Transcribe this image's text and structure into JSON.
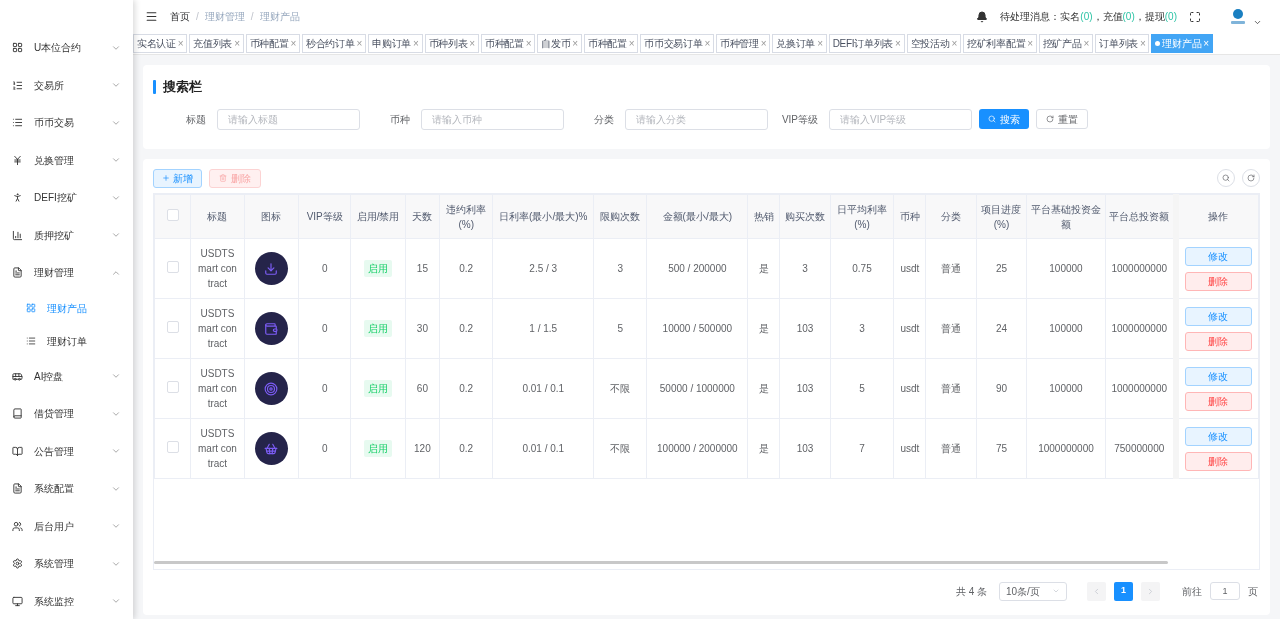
{
  "breadcrumb": {
    "items": [
      "首页",
      "理财管理",
      "理财产品"
    ],
    "separator": "/"
  },
  "notice": {
    "label": "待处理消息：",
    "items": [
      {
        "label": "实名",
        "count": "(0)"
      },
      {
        "label": "，充值",
        "count": "(0)"
      },
      {
        "label": "，提现",
        "count": "(0)"
      }
    ]
  },
  "sidebar": {
    "items": [
      {
        "label": "U本位合约",
        "expanded": false
      },
      {
        "label": "交易所",
        "expanded": false
      },
      {
        "label": "币币交易",
        "expanded": false
      },
      {
        "label": "兑换管理",
        "expanded": false
      },
      {
        "label": "DEFI挖矿",
        "expanded": false
      },
      {
        "label": "质押挖矿",
        "expanded": false
      },
      {
        "label": "理财管理",
        "expanded": true,
        "children": [
          {
            "label": "理财产品",
            "selected": true
          },
          {
            "label": "理财订单",
            "selected": false
          }
        ]
      },
      {
        "label": "AI控盘",
        "expanded": false
      },
      {
        "label": "借贷管理",
        "expanded": false
      },
      {
        "label": "公告管理",
        "expanded": false
      },
      {
        "label": "系统配置",
        "expanded": false
      },
      {
        "label": "后台用户",
        "expanded": false
      },
      {
        "label": "系统管理",
        "expanded": false
      },
      {
        "label": "系统监控",
        "expanded": false
      }
    ]
  },
  "tabs": [
    {
      "label": "实名认证",
      "close": "×",
      "selected": false
    },
    {
      "label": "充值列表",
      "close": "×",
      "selected": false
    },
    {
      "label": "币种配置",
      "close": "×",
      "selected": false
    },
    {
      "label": "秒合约订单",
      "close": "×",
      "selected": false
    },
    {
      "label": "申购订单",
      "close": "×",
      "selected": false
    },
    {
      "label": "币种列表",
      "close": "×",
      "selected": false
    },
    {
      "label": "币种配置",
      "close": "×",
      "selected": false
    },
    {
      "label": "自发币",
      "close": "×",
      "selected": false
    },
    {
      "label": "币种配置",
      "close": "×",
      "selected": false
    },
    {
      "label": "币币交易订单",
      "close": "×",
      "selected": false
    },
    {
      "label": "币种管理",
      "close": "×",
      "selected": false
    },
    {
      "label": "兑换订单",
      "close": "×",
      "selected": false
    },
    {
      "label": "DEFI订单列表",
      "close": "×",
      "selected": false
    },
    {
      "label": "空投活动",
      "close": "×",
      "selected": false
    },
    {
      "label": "挖矿利率配置",
      "close": "×",
      "selected": false
    },
    {
      "label": "挖矿产品",
      "close": "×",
      "selected": false
    },
    {
      "label": "订单列表",
      "close": "×",
      "selected": false
    },
    {
      "label": "理财产品",
      "close": "×",
      "selected": true
    }
  ],
  "search_panel": {
    "title": "搜索栏",
    "fields": [
      {
        "label": "标题",
        "placeholder": "请输入标题"
      },
      {
        "label": "币种",
        "placeholder": "请输入币种"
      },
      {
        "label": "分类",
        "placeholder": "请输入分类"
      },
      {
        "label": "VIP等级",
        "placeholder": "请输入VIP等级"
      }
    ],
    "search_button": "搜索",
    "reset_button": "重置"
  },
  "toolbar": {
    "add_button": "新增",
    "delete_button": {
      "label": "删除",
      "disabled": true
    }
  },
  "table": {
    "select_all_checked": false,
    "columns": [
      "标题",
      "图标",
      "VIP等级",
      "启用/禁用",
      "天数",
      "违约利率(%)",
      "日利率(最小/最大)%",
      "限购次数",
      "金额(最小/最大)",
      "热销",
      "购买次数",
      "日平均利率(%)",
      "币种",
      "分类",
      "项目进度(%)",
      "平台基础投资金额",
      "平台总投资额",
      "操作"
    ],
    "rows": [
      {
        "checked": false,
        "title": "USDTSmart contract",
        "vip": "0",
        "status": {
          "label": "启用",
          "on": true
        },
        "days": "15",
        "penalty": "0.2",
        "daily_rate": "2.5 / 3",
        "limit": "3",
        "amount": "500 / 200000",
        "hot": "是",
        "purchases": "3",
        "avg_rate": "0.75",
        "coin": "usdt",
        "category": "普通",
        "progress": "25",
        "base_investment": "100000",
        "total_investment": "1000000000",
        "actions": [
          "修改",
          "删除"
        ]
      },
      {
        "checked": false,
        "title": "USDTSmart contract",
        "vip": "0",
        "status": {
          "label": "启用",
          "on": true
        },
        "days": "30",
        "penalty": "0.2",
        "daily_rate": "1 / 1.5",
        "limit": "5",
        "amount": "10000 / 500000",
        "hot": "是",
        "purchases": "103",
        "avg_rate": "3",
        "coin": "usdt",
        "category": "普通",
        "progress": "24",
        "base_investment": "100000",
        "total_investment": "1000000000",
        "actions": [
          "修改",
          "删除"
        ]
      },
      {
        "checked": false,
        "title": "USDTSmart contract",
        "vip": "0",
        "status": {
          "label": "启用",
          "on": true
        },
        "days": "60",
        "penalty": "0.2",
        "daily_rate": "0.01 / 0.1",
        "limit": "不限",
        "amount": "50000 / 1000000",
        "hot": "是",
        "purchases": "103",
        "avg_rate": "5",
        "coin": "usdt",
        "category": "普通",
        "progress": "90",
        "base_investment": "100000",
        "total_investment": "1000000000",
        "actions": [
          "修改",
          "删除"
        ]
      },
      {
        "checked": false,
        "title": "USDTSmart contract",
        "vip": "0",
        "status": {
          "label": "启用",
          "on": true
        },
        "days": "120",
        "penalty": "0.2",
        "daily_rate": "0.01 / 0.1",
        "limit": "不限",
        "amount": "100000 / 2000000",
        "hot": "是",
        "purchases": "103",
        "avg_rate": "7",
        "coin": "usdt",
        "category": "普通",
        "progress": "75",
        "base_investment": "1000000000",
        "total_investment": "750000000",
        "actions": [
          "修改",
          "删除"
        ]
      }
    ]
  },
  "pagination": {
    "total": "共 4 条",
    "page_size": "10条/页",
    "pages": [
      {
        "label": "1",
        "selected": true
      }
    ],
    "goto_label": "前往",
    "goto_value": "1",
    "page_suffix": "页"
  }
}
